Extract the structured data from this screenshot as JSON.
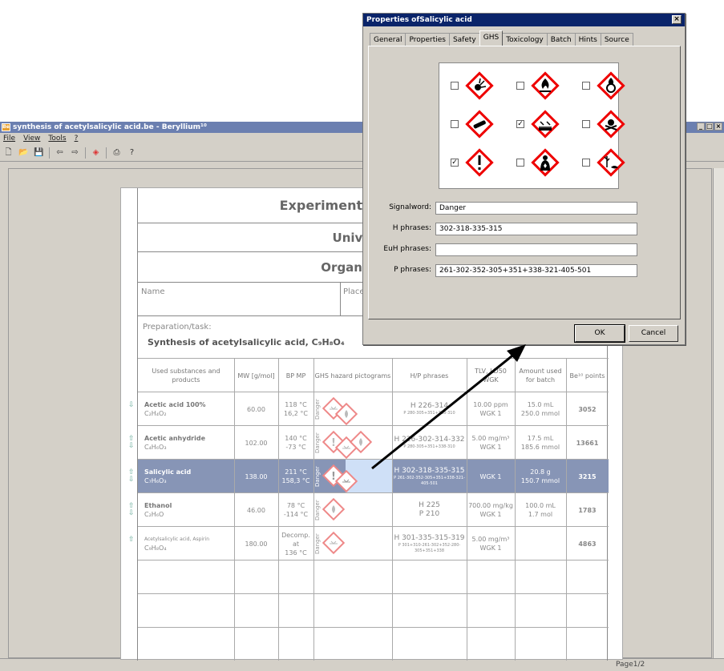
{
  "app": {
    "window_title": "synthesis of acetylsalicylic acid.be - Beryllium¹⁰",
    "icon_text": "Be",
    "menu": [
      "File",
      "View",
      "Tools",
      "?"
    ],
    "status_page": "Page1/2"
  },
  "doc": {
    "heading1": "Experimentwise safety da",
    "heading2": "University o",
    "heading3": "Organic chemis",
    "name_label": "Name",
    "place_label": "Place",
    "prep_label": "Preparation/task:",
    "prep_title": "Synthesis of acetylsalicylic acid, C₉H₈O₄"
  },
  "table": {
    "headers": {
      "substance": "Used substances and products",
      "mw": "MW [g/mol]",
      "bpmp": "BP MP",
      "ghs": "GHS hazard pictograms",
      "hp": "H/P phrases",
      "tlv": "TLV, LD50 WGK",
      "amount": "Amount used for batch",
      "points": "Be¹⁰ points"
    },
    "danger_word": "Danger",
    "rows": [
      {
        "name": "Acetic acid 100%",
        "formula": "C₂H₄O₂",
        "mw": "60.00",
        "bp": "118 °C",
        "mp": "16,2 °C",
        "h": "H 226-314",
        "p": "P 280-305+351+338-310",
        "tlv1": "10.00 ppm",
        "tlv2": "WGK 1",
        "amt1": "15.0 mL",
        "amt2": "250.0 mmol",
        "points": "3052"
      },
      {
        "name": "Acetic anhydride",
        "formula": "C₄H₆O₃",
        "mw": "102.00",
        "bp": "140 °C",
        "mp": "-73 °C",
        "h": "H 226-302-314-332",
        "p": "P 280-305+351+338-310",
        "tlv1": "5.00 mg/m³",
        "tlv2": "WGK 1",
        "amt1": "17.5 mL",
        "amt2": "185.6 mmol",
        "points": "13661"
      },
      {
        "name": "Salicylic acid",
        "formula": "C₇H₆O₃",
        "mw": "138.00",
        "bp": "211 °C",
        "mp": "158,3 °C",
        "h": "H 302-318-335-315",
        "p": "P 261-302-352-305+351+338-321-405-501",
        "tlv1": "",
        "tlv2": "WGK 1",
        "amt1": "20.8 g",
        "amt2": "150.7 mmol",
        "points": "3215"
      },
      {
        "name": "Ethanol",
        "formula": "C₂H₆O",
        "mw": "46.00",
        "bp": "78 °C",
        "mp": "-114 °C",
        "h": "H 225",
        "p": "P 210",
        "tlv1": "700.00 mg/kg",
        "tlv2": "WGK 1",
        "amt1": "100.0 mL",
        "amt2": "1.7 mol",
        "points": "1783"
      },
      {
        "name": "Acetylsalicylic acid, Aspirin",
        "formula": "C₉H₈O₄",
        "mw": "180.00",
        "bp": "Decomp. at",
        "mp": "136 °C",
        "h": "H 301-335-315-319",
        "p": "P 301+310-261-302+352-280-305+351+338",
        "tlv1": "5.00 mg/m³",
        "tlv2": "WGK 1",
        "amt1": "",
        "amt2": "",
        "points": "4863"
      }
    ]
  },
  "dialog": {
    "title": "Properties ofSalicylic acid",
    "close": "×",
    "tabs": [
      "General",
      "Properties",
      "Safety",
      "GHS",
      "Toxicology",
      "Batch",
      "Hints",
      "Source"
    ],
    "active_tab": "GHS",
    "pictograms": [
      {
        "name": "exploding-bomb-icon",
        "checked": false
      },
      {
        "name": "flame-icon",
        "checked": false
      },
      {
        "name": "flame-over-circle-icon",
        "checked": false
      },
      {
        "name": "gas-cylinder-icon",
        "checked": false
      },
      {
        "name": "corrosion-icon",
        "checked": true
      },
      {
        "name": "skull-crossbones-icon",
        "checked": false
      },
      {
        "name": "exclamation-mark-icon",
        "checked": true
      },
      {
        "name": "health-hazard-icon",
        "checked": false
      },
      {
        "name": "environment-icon",
        "checked": false
      }
    ],
    "check_mark": "✓",
    "signalword_label": "Signalword:",
    "signalword": "Danger",
    "h_label": "H phrases:",
    "h_value": "302-318-335-315",
    "euh_label": "EuH phrases:",
    "euh_value": "",
    "p_label": "P phrases:",
    "p_value": "261-302-352-305+351+338-321-405-501",
    "ok": "OK",
    "cancel": "Cancel"
  }
}
